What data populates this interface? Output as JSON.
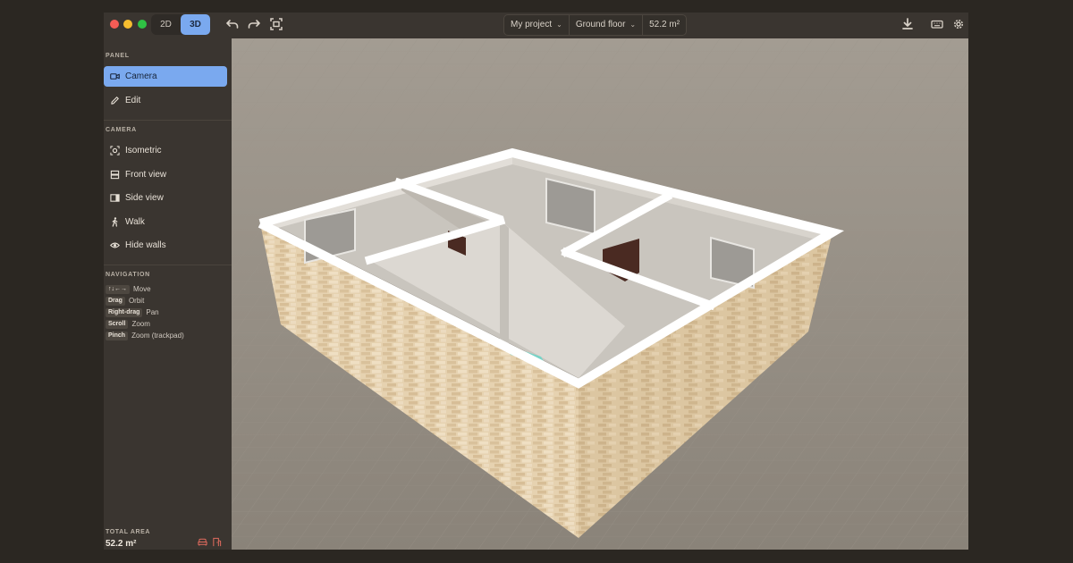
{
  "toolbar": {
    "mode_2d": "2D",
    "mode_3d": "3D",
    "active_mode": "3D",
    "project": "My project",
    "floor": "Ground floor",
    "area": "52.2 m²",
    "icons": [
      "undo-icon",
      "redo-icon",
      "fit-view-icon",
      "download-icon",
      "keyboard-icon",
      "settings-icon"
    ]
  },
  "sidebar": {
    "panel_heading": "PANEL",
    "panel_items": [
      {
        "label": "Camera",
        "icon": "video-camera-icon",
        "active": true
      },
      {
        "label": "Edit",
        "icon": "pencil-icon",
        "active": false
      }
    ],
    "camera_heading": "CAMERA",
    "camera_items": [
      {
        "label": "Isometric",
        "icon": "isometric-icon"
      },
      {
        "label": "Front view",
        "icon": "front-view-icon"
      },
      {
        "label": "Side view",
        "icon": "side-view-icon"
      },
      {
        "label": "Walk",
        "icon": "walk-icon"
      },
      {
        "label": "Hide walls",
        "icon": "eye-icon"
      }
    ],
    "navigation_heading": "NAVIGATION",
    "navigation": [
      {
        "key": "↑↓←→",
        "action": "Move"
      },
      {
        "key": "Drag",
        "action": "Orbit"
      },
      {
        "key": "Right-drag",
        "action": "Pan"
      },
      {
        "key": "Scroll",
        "action": "Zoom"
      },
      {
        "key": "Pinch",
        "action": "Zoom (trackpad)"
      }
    ],
    "total_area_label": "TOTAL AREA",
    "total_area_value": "52.2 m²"
  },
  "colors": {
    "accent": "#7aa9ef",
    "chrome": "#3a3530",
    "floor_ground": "#8e877d",
    "brick": "#e6d2b0",
    "wall_top": "#ffffff",
    "interior": "#cfcbc4"
  }
}
